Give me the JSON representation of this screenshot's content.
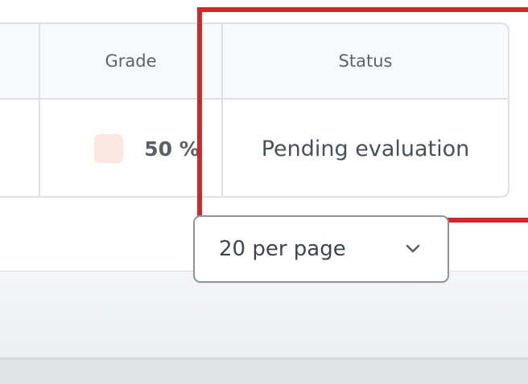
{
  "table": {
    "columns": [
      {
        "key": "grade",
        "label": "Grade"
      },
      {
        "key": "status",
        "label": "Status"
      }
    ],
    "rows": [
      {
        "grade": "50 %",
        "status": "Pending evaluation"
      }
    ]
  },
  "pagination": {
    "per_page_label": "20 per page"
  },
  "colors": {
    "highlight": "#cc2a2a",
    "grade_swatch": "#fbe7e1",
    "border": "#dde1e6"
  },
  "icons": {
    "select_chevron": "chevron-down-icon"
  }
}
